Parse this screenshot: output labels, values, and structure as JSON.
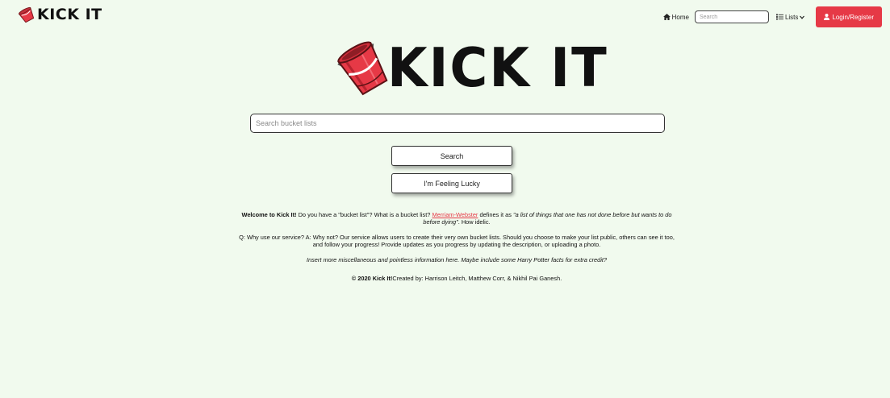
{
  "navbar": {
    "brand": "KICK IT",
    "home_label": "Home",
    "search_placeholder": "Search",
    "lists_label": "Lists",
    "login_label": "Login/Register"
  },
  "hero": {
    "logo_text": "KICK IT"
  },
  "main_search": {
    "placeholder": "Search bucket lists"
  },
  "buttons": {
    "search": "Search",
    "lucky": "I'm Feeling Lucky"
  },
  "intro": {
    "welcome_bold": "Welcome to Kick It!",
    "text1": " Do you have a \"bucket list\"? What is a bucket list? ",
    "link": "Merriam-Webster",
    "text2": " defines it as ",
    "definition": "\"a list of things that one has not done before but wants to do before dying\"",
    "text3": ". How idelic."
  },
  "qa": "Q: Why use our service? A: Why not? Our service allows users to create their very own bucket lists. Should you choose to make your list public, others can see it too, and follow your progress! Provide updates as you progress by updating the description, or uploading a photo.",
  "misc": "Insert more miscellaneous and pointless information here. Maybe include some Harry Potter facts for extra credit?",
  "footer": {
    "copyright": "© 2020 Kick It!",
    "credits": "Created by: Harrison Leitch, Matthew Corr, & Nikhil Pai Ganesh."
  },
  "colors": {
    "background": "#f1faee",
    "accent": "#e63946"
  }
}
